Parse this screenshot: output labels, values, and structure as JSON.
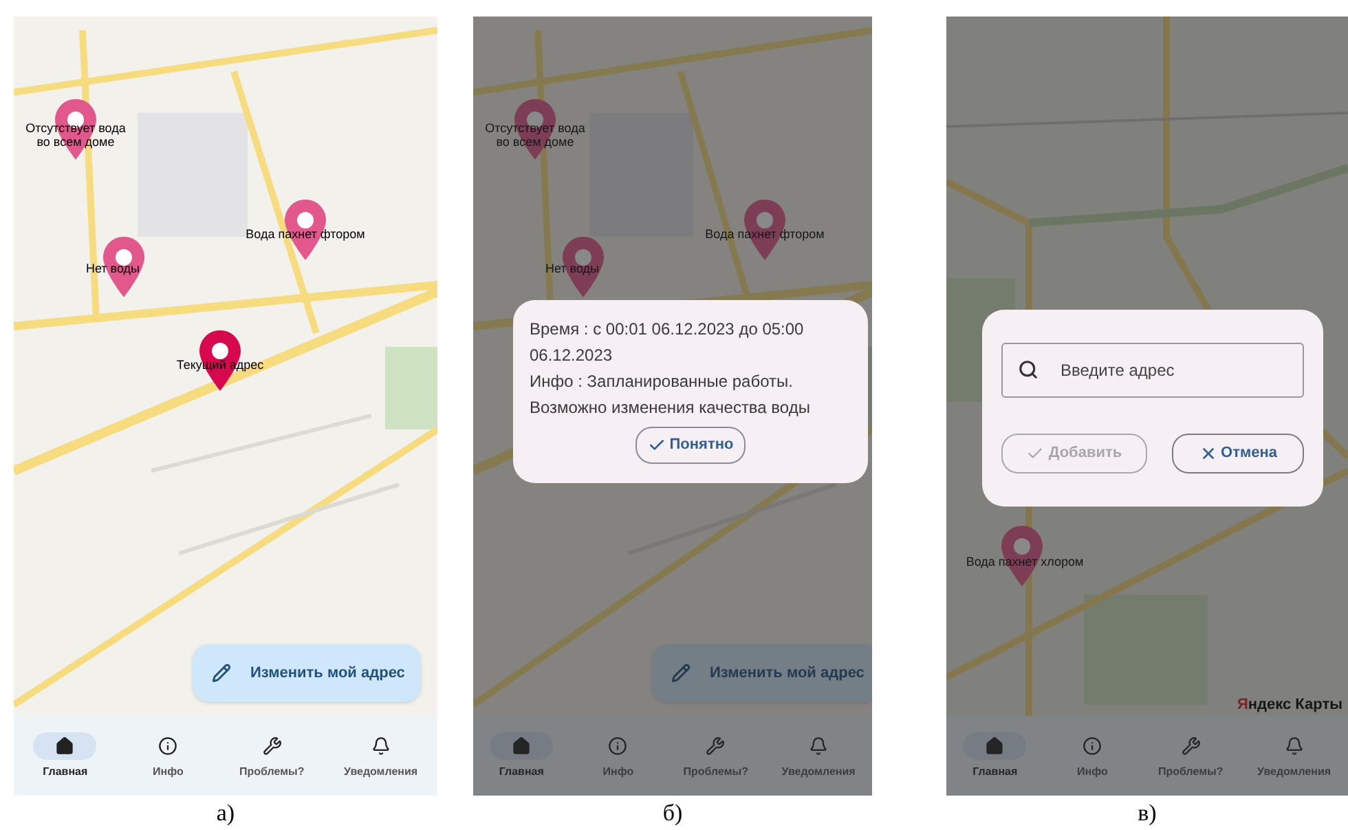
{
  "figure": [
    {
      "caption": "а)",
      "markers": [
        {
          "label": "Отсутствует вода во всем доме",
          "current": false
        },
        {
          "label": "Нет воды",
          "current": false
        },
        {
          "label": "Вода пахнет фтором",
          "current": false
        },
        {
          "label": "Текущий адрес",
          "current": true
        }
      ],
      "fab": {
        "label": "Изменить мой адрес"
      },
      "nav": [
        {
          "label": "Главная",
          "selected": true
        },
        {
          "label": "Инфо",
          "selected": false
        },
        {
          "label": "Проблемы?",
          "selected": false
        },
        {
          "label": "Уведомления",
          "selected": false
        }
      ]
    },
    {
      "caption": "б)",
      "dimmed": true,
      "markers": [
        {
          "label": "Отсутствует вода во всем доме",
          "current": false
        },
        {
          "label": "Нет воды",
          "current": false
        },
        {
          "label": "Вода пахнет фтором",
          "current": false
        }
      ],
      "fab": {
        "label": "Изменить мой адрес"
      },
      "dialog": {
        "kind": "info",
        "paragraphs": [
          "Время : с 00:01 06.12.2023 до 05:00 06.12.2023",
          "Инфо : Запланированные работы. Возможно изменения качества воды"
        ],
        "button": "Понятно"
      },
      "nav": [
        {
          "label": "Главная",
          "selected": true
        },
        {
          "label": "Инфо",
          "selected": false
        },
        {
          "label": "Проблемы?",
          "selected": false
        },
        {
          "label": "Уведомления",
          "selected": false
        }
      ]
    },
    {
      "caption": "в)",
      "dimmed": true,
      "markers": [
        {
          "label": "Вода пахнет хлором",
          "current": false
        }
      ],
      "map_logo": "Яндекс Карты",
      "dialog": {
        "kind": "address",
        "placeholder": "Введите адрес",
        "buttons": [
          {
            "label": "Добавить",
            "disabled": true
          },
          {
            "label": "Отмена",
            "disabled": false
          }
        ]
      },
      "nav": [
        {
          "label": "Главная",
          "selected": true
        },
        {
          "label": "Инфо",
          "selected": false
        },
        {
          "label": "Проблемы?",
          "selected": false
        },
        {
          "label": "Уведомления",
          "selected": false
        }
      ]
    }
  ]
}
